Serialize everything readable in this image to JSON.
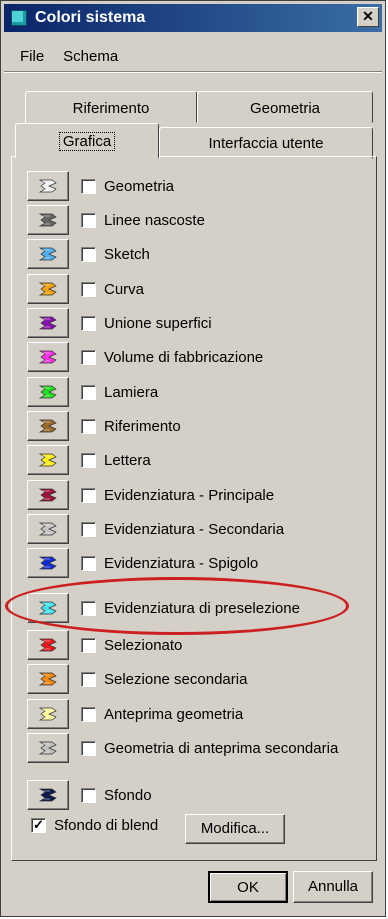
{
  "window": {
    "title": "Colori sistema",
    "close_glyph": "✕"
  },
  "menu": [
    "File",
    "Schema"
  ],
  "tabs": {
    "back": [
      "Riferimento",
      "Geometria"
    ],
    "front": [
      "Grafica",
      "Interfaccia utente"
    ],
    "active": "Grafica"
  },
  "items": [
    {
      "label": "Geometria",
      "color": "#f4f4f4"
    },
    {
      "label": "Linee nascoste",
      "color": "#666666"
    },
    {
      "label": "Sketch",
      "color": "#4fb0f0"
    },
    {
      "label": "Curva",
      "color": "#f2a20c"
    },
    {
      "label": "Unione superfici",
      "color": "#8b12b0"
    },
    {
      "label": "Volume di fabbricazione",
      "color": "#ff2ee8"
    },
    {
      "label": "Lamiera",
      "color": "#22e01f"
    },
    {
      "label": "Riferimento",
      "color": "#9b6a2a"
    },
    {
      "label": "Lettera",
      "color": "#ffee17"
    },
    {
      "label": "Evidenziatura - Principale",
      "color": "#a0123c"
    },
    {
      "label": "Evidenziatura - Secondaria",
      "color": "#c4c4c4"
    },
    {
      "label": "Evidenziatura - Spigolo",
      "color": "#102ad6"
    },
    {
      "label": "Evidenziatura di preselezione",
      "color": "#43e6f0"
    },
    {
      "label": "Selezionato",
      "color": "#f01818"
    },
    {
      "label": "Selezione secondaria",
      "color": "#f2880f"
    },
    {
      "label": "Anteprima geometria",
      "color": "#fffca0"
    },
    {
      "label": "Geometria di anteprima secondaria",
      "color": "#c0c0c0"
    }
  ],
  "background": {
    "label": "Sfondo",
    "color": "#0b1a4a"
  },
  "blend": {
    "label": "Sfondo di blend",
    "checked": true,
    "check_glyph": "✓",
    "modify_label": "Modifica..."
  },
  "buttons": {
    "ok": "OK",
    "cancel": "Annulla"
  },
  "annotation": {
    "color": "#cc1f1f",
    "target": "Evidenziatura di preselezione"
  }
}
